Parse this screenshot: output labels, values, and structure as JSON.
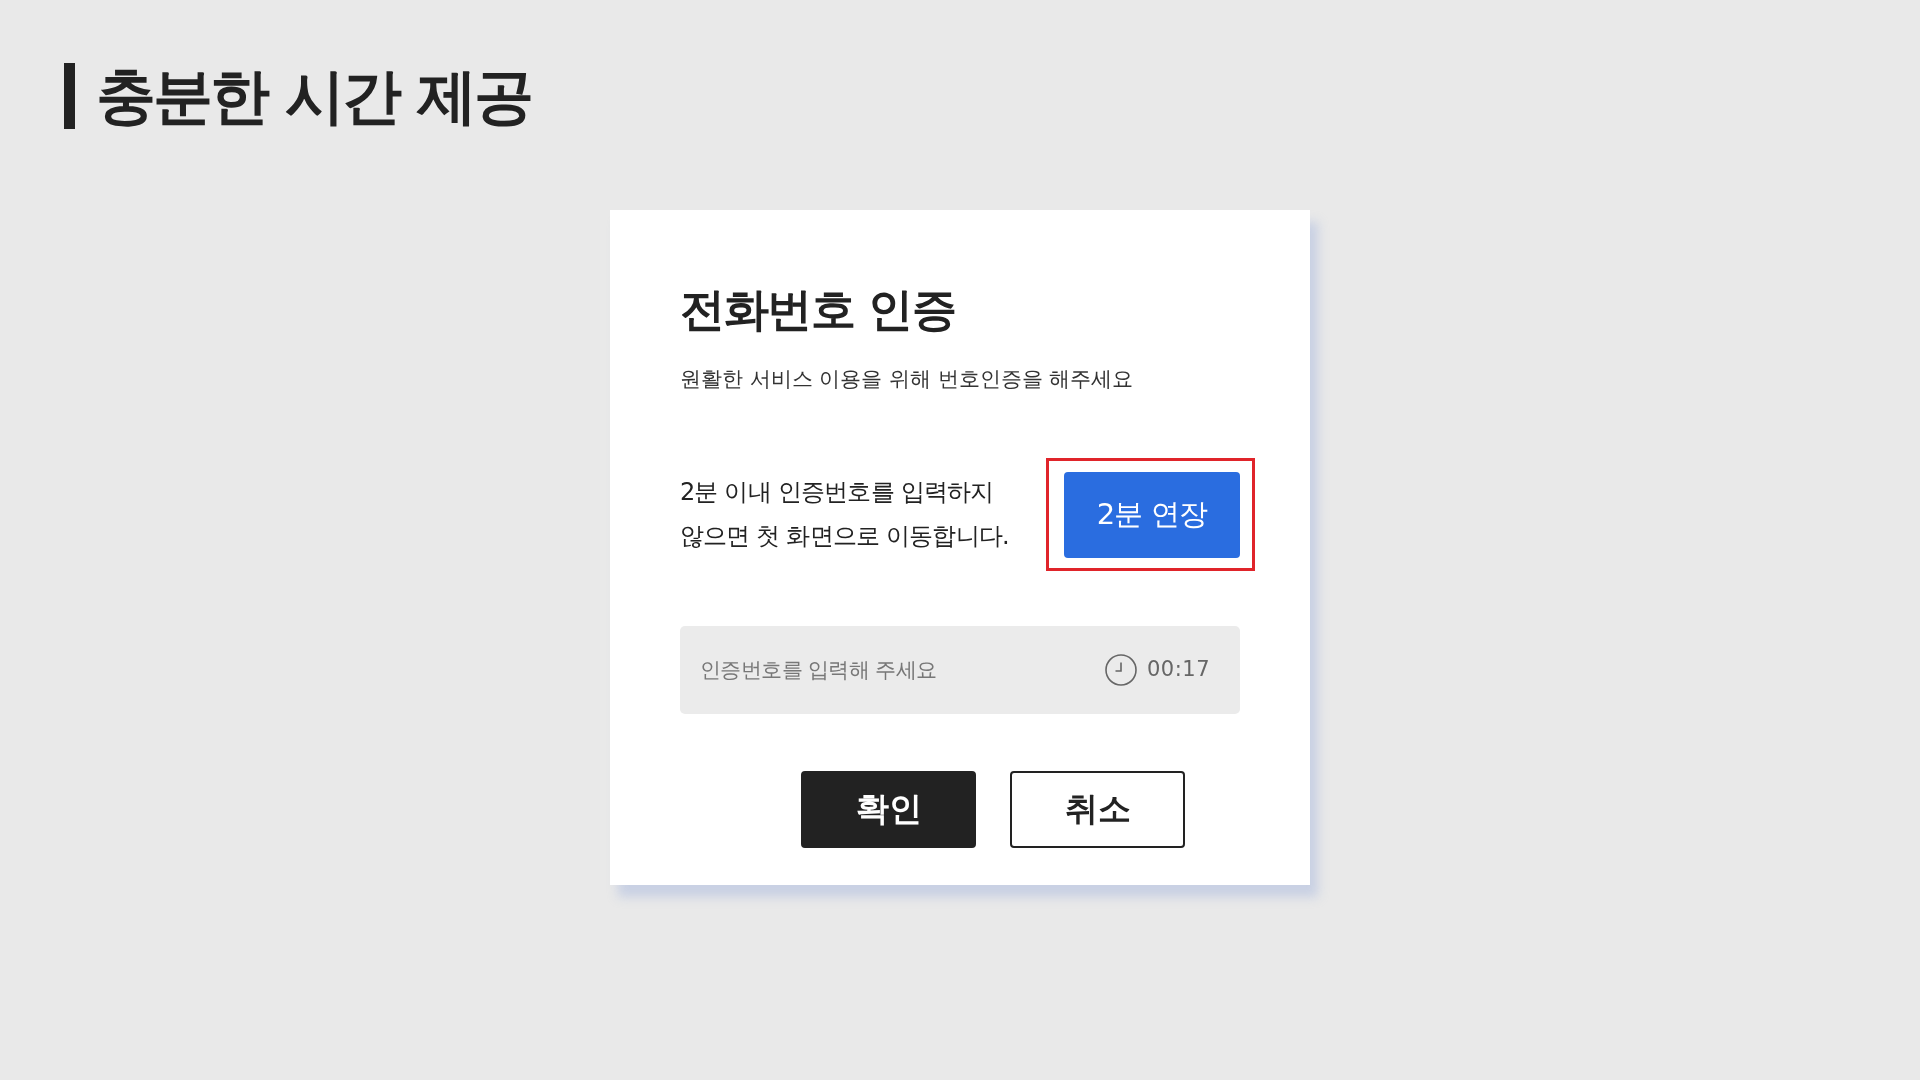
{
  "heading": {
    "title": "충분한 시간 제공"
  },
  "dialog": {
    "title": "전화번호 인증",
    "subtitle": "원활한 서비스 이용을 위해 번호인증을 해주세요",
    "notice": "2분 이내 인증번호를 입력하지 않으면 첫 화면으로 이동합니다.",
    "extend_button": {
      "label": "2분 연장",
      "highlighted": true
    },
    "code_field": {
      "placeholder": "인증번호를 입력해 주세요",
      "timer": "00:17"
    },
    "buttons": [
      {
        "label": "확인",
        "kind": "primary"
      },
      {
        "label": "취소",
        "kind": "outline"
      }
    ]
  }
}
